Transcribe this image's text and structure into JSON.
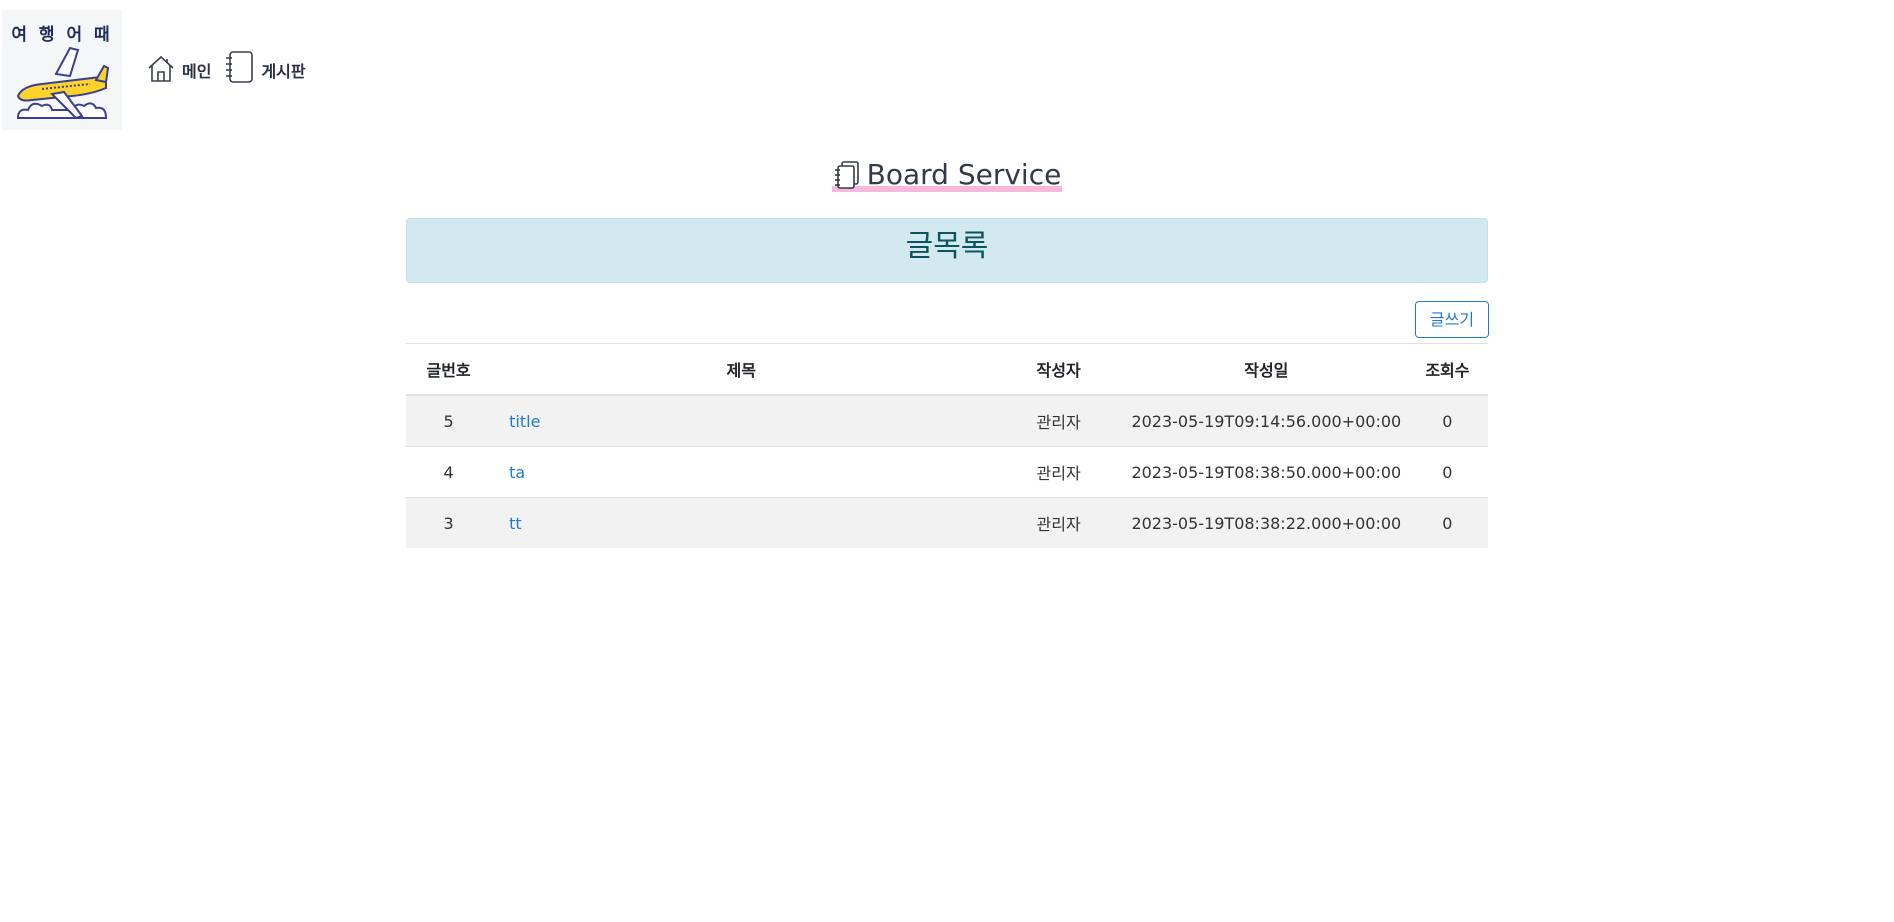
{
  "header": {
    "logo_text": "여 행 어 때",
    "nav": [
      {
        "label": "메인",
        "icon": "home-icon"
      },
      {
        "label": "게시판",
        "icon": "notebook-icon"
      }
    ]
  },
  "page_title": "Board Service",
  "alert_text": "글목록",
  "write_button": "글쓰기",
  "table": {
    "headers": [
      "글번호",
      "제목",
      "작성자",
      "작성일",
      "조회수"
    ],
    "rows": [
      {
        "no": "5",
        "title": "title",
        "writer": "관리자",
        "date": "2023-05-19T09:14:56.000+00:00",
        "views": "0"
      },
      {
        "no": "4",
        "title": "ta",
        "writer": "관리자",
        "date": "2023-05-19T08:38:50.000+00:00",
        "views": "0"
      },
      {
        "no": "3",
        "title": "tt",
        "writer": "관리자",
        "date": "2023-05-19T08:38:22.000+00:00",
        "views": "0"
      }
    ]
  },
  "colors": {
    "accent": "#1e7ad6",
    "alert_bg": "#d1e9ef",
    "title_highlight": "#f6b9dc",
    "stripe": "#f2f2f2"
  }
}
